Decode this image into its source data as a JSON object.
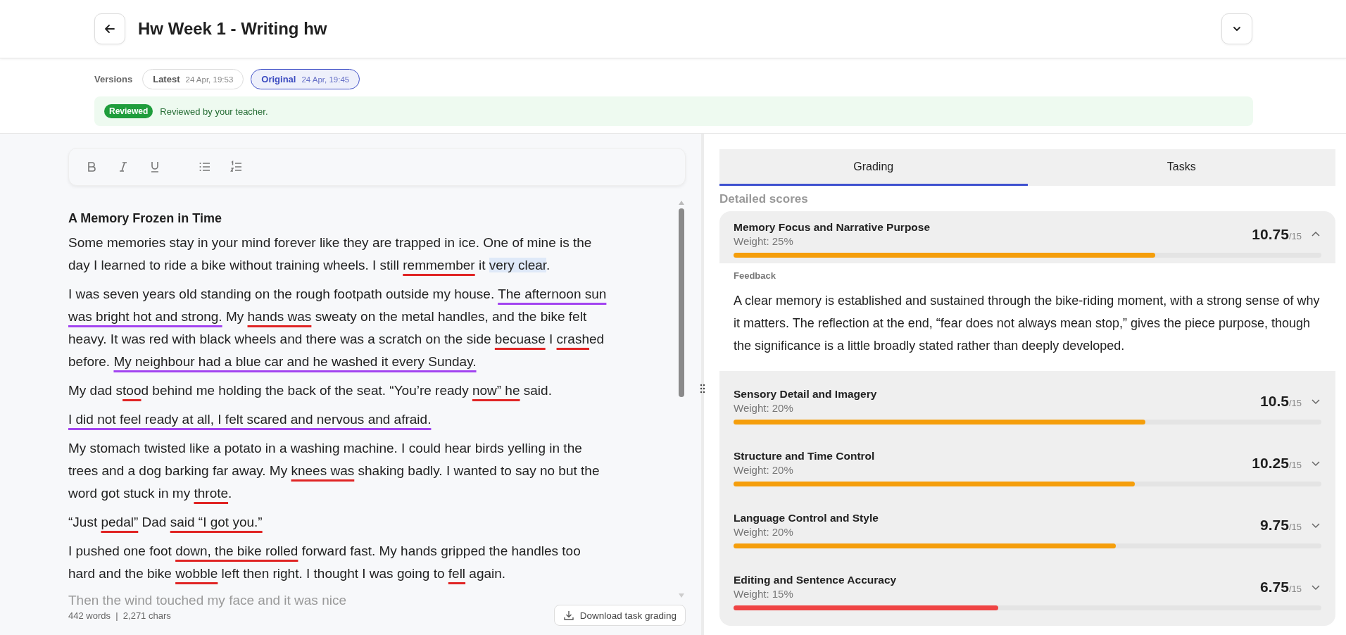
{
  "header": {
    "title": "Hw Week 1 - Writing hw"
  },
  "versions": {
    "label": "Versions",
    "items": [
      {
        "name": "Latest",
        "time": "24 Apr, 19:53",
        "selected": false
      },
      {
        "name": "Original",
        "time": "24 Apr, 19:45",
        "selected": true
      }
    ]
  },
  "review": {
    "badge": "Reviewed",
    "message": "Reviewed by your teacher."
  },
  "editor": {
    "title": "A Memory Frozen in Time",
    "paragraphs": [
      {
        "segments": [
          {
            "text": "Some memories stay in your mind forever like they are trapped in ice. One of mine is the day I learned to ride a bike without training wheels. I still ",
            "kind": "plain"
          },
          {
            "text": "remmember",
            "kind": "error"
          },
          {
            "text": " it ",
            "kind": "plain"
          },
          {
            "text": "very clear",
            "kind": "highlight"
          },
          {
            "text": ".",
            "kind": "plain"
          }
        ],
        "faded": false
      },
      {
        "segments": [
          {
            "text": "I was seven years old standing on the rough footpath outside my house. ",
            "kind": "plain"
          },
          {
            "text": "The afternoon sun was bright hot and strong.",
            "kind": "style"
          },
          {
            "text": " My ",
            "kind": "plain"
          },
          {
            "text": "hands was",
            "kind": "error"
          },
          {
            "text": " sweaty on the metal handles, and the bike felt heavy. It was red with black wheels and there was a scratch on the side ",
            "kind": "plain"
          },
          {
            "text": "becuase",
            "kind": "error"
          },
          {
            "text": " I ",
            "kind": "plain"
          },
          {
            "text": "crash",
            "kind": "error"
          },
          {
            "text": "ed before. ",
            "kind": "plain"
          },
          {
            "text": "My neighbour had a blue car and he washed it every Sunday.",
            "kind": "style"
          }
        ],
        "faded": false
      },
      {
        "segments": [
          {
            "text": "My dad s",
            "kind": "plain"
          },
          {
            "text": "too",
            "kind": "error"
          },
          {
            "text": "d behind me holding the back of the seat. “You’re ready ",
            "kind": "plain"
          },
          {
            "text": "now” he",
            "kind": "error"
          },
          {
            "text": " said.",
            "kind": "plain"
          }
        ],
        "faded": false
      },
      {
        "segments": [
          {
            "text": "I did not feel ready at all, I felt scared and nervous and afraid.",
            "kind": "style"
          }
        ],
        "faded": false
      },
      {
        "segments": [
          {
            "text": "My stomach twisted like a potato in a washing machine. I could hear birds yelling in the trees and a dog barking far away. My ",
            "kind": "plain"
          },
          {
            "text": "knees was",
            "kind": "error"
          },
          {
            "text": " shaking badly. I wanted to say no but the word got stuck in my ",
            "kind": "plain"
          },
          {
            "text": "throte",
            "kind": "error"
          },
          {
            "text": ".",
            "kind": "plain"
          }
        ],
        "faded": false
      },
      {
        "segments": [
          {
            "text": "“Just ",
            "kind": "plain"
          },
          {
            "text": "pedal”",
            "kind": "error"
          },
          {
            "text": " Dad ",
            "kind": "plain"
          },
          {
            "text": "said “I got you.”",
            "kind": "error"
          }
        ],
        "faded": false
      },
      {
        "segments": [
          {
            "text": "I pushed one foot ",
            "kind": "plain"
          },
          {
            "text": "down, the bike rolled",
            "kind": "error"
          },
          {
            "text": " forward fast. My hands gripped the handles too hard and the bike ",
            "kind": "plain"
          },
          {
            "text": "wobble",
            "kind": "error"
          },
          {
            "text": " left then right. I thought I was going to ",
            "kind": "plain"
          },
          {
            "text": "fell",
            "kind": "error"
          },
          {
            "text": " again.",
            "kind": "plain"
          }
        ],
        "faded": false
      },
      {
        "segments": [
          {
            "text": "Then the wind touched my face and it was nice",
            "kind": "plain"
          }
        ],
        "faded": true
      }
    ],
    "stats": "442 words  |  2,271 chars",
    "download": "Download task grading"
  },
  "tabs": [
    {
      "label": "Grading",
      "selected": true
    },
    {
      "label": "Tasks",
      "selected": false
    }
  ],
  "scores": {
    "title": "Detailed scores",
    "feedback_label": "Feedback",
    "criteria": [
      {
        "name": "Memory Focus and Narrative Purpose",
        "weight": "Weight: 25%",
        "score": "10.75",
        "max": "/15",
        "level": 0.717,
        "color": "#f59e0b",
        "expanded": true,
        "feedback": "A clear memory is established and sustained through the bike-riding moment, with a strong sense of why it matters. The reflection at the end, “fear does not always mean stop,” gives the piece purpose, though the significance is a little broadly stated rather than deeply developed."
      },
      {
        "name": "Sensory Detail and Imagery",
        "weight": "Weight: 20%",
        "score": "10.5",
        "max": "/15",
        "level": 0.7,
        "color": "#f59e0b",
        "expanded": false
      },
      {
        "name": "Structure and Time Control",
        "weight": "Weight: 20%",
        "score": "10.25",
        "max": "/15",
        "level": 0.683,
        "color": "#f59e0b",
        "expanded": false
      },
      {
        "name": "Language Control and Style",
        "weight": "Weight: 20%",
        "score": "9.75",
        "max": "/15",
        "level": 0.65,
        "color": "#f59e0b",
        "expanded": false
      },
      {
        "name": "Editing and Sentence Accuracy",
        "weight": "Weight: 15%",
        "score": "6.75",
        "max": "/15",
        "level": 0.45,
        "color": "#ef4444",
        "expanded": false
      }
    ]
  }
}
